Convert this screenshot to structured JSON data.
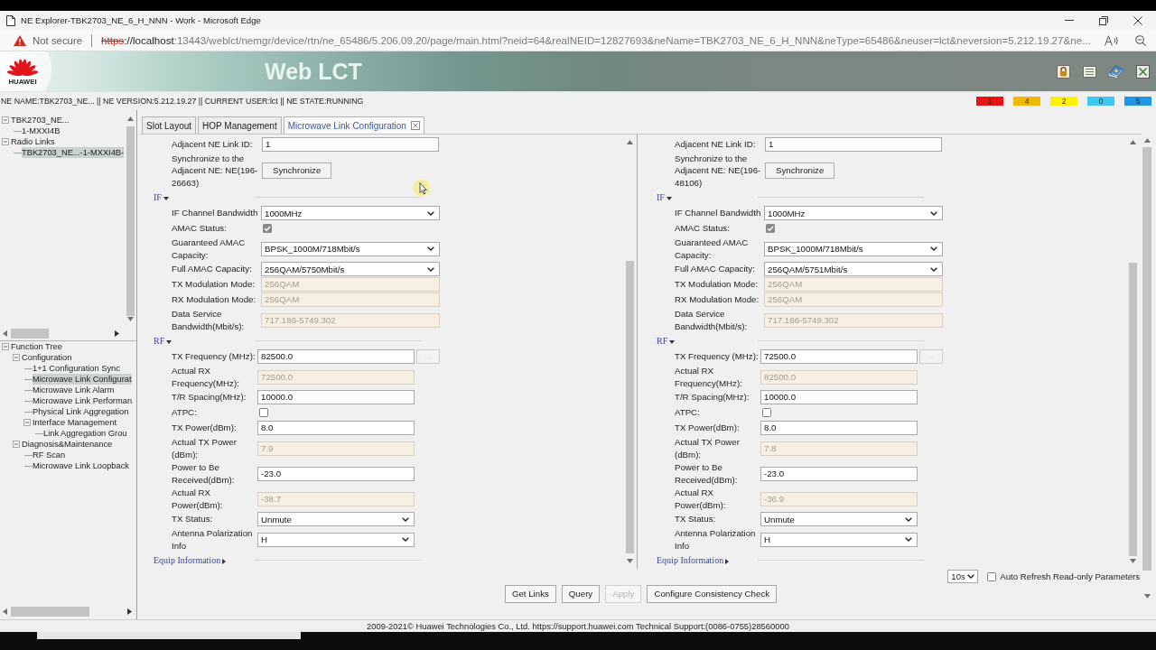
{
  "browser": {
    "title": "NE Explorer-TBK2703_NE_6_H_NNN - Work - Microsoft Edge",
    "security_label": "Not secure",
    "url_parts": [
      {
        "kind": "scheme",
        "text": "https"
      },
      {
        "kind": "host",
        "text": "://localhost"
      },
      {
        "kind": "path",
        "text": ":13443/weblct/nemgr/device/rtn/ne_65486/5.206.09.20/page/main.html?neid=64&realNEID=12827693&neName=TBK2703_NE_6_H_NNN&neType=65486&neuser=lct&neversion=5.212.19.27&ne..."
      }
    ]
  },
  "header": {
    "logo_text": "HUAWEI",
    "title": "Web LCT"
  },
  "status_bar": {
    "ne_info": "NE NAME:TBK2703_NE... || NE VERSION:5.212.19.27 || CURRENT USER:lct || NE STATE:RUNNING",
    "alarm_counts": [
      {
        "count": "1",
        "color": "#e81212"
      },
      {
        "count": "4",
        "color": "#f2b705"
      },
      {
        "count": "2",
        "color": "#fff200"
      },
      {
        "count": "0",
        "color": "#3cc8f0"
      },
      {
        "count": "5",
        "color": "#1e96e6"
      }
    ]
  },
  "ne_tree": [
    {
      "label": "TBK2703_NE...",
      "expanded": true,
      "selected": false,
      "children": [
        {
          "label": "1-MXXI4B",
          "selected": false
        }
      ]
    },
    {
      "label": "Radio Links",
      "expanded": true,
      "selected": false,
      "children": [
        {
          "label": "TBK2703_NE...-1-MXXI4B-",
          "selected": true
        }
      ]
    }
  ],
  "function_tree": [
    {
      "label": "Function Tree",
      "expanded": true,
      "selected": false,
      "children": [
        {
          "label": "Configuration",
          "expanded": true,
          "selected": false,
          "children": [
            {
              "label": "1+1 Configuration Sync",
              "selected": false
            },
            {
              "label": "Microwave Link Configurat",
              "selected": true
            },
            {
              "label": "Microwave Link Alarm",
              "selected": false
            },
            {
              "label": "Microwave Link Performan",
              "selected": false
            },
            {
              "label": "Physical Link Aggregation",
              "selected": false
            },
            {
              "label": "Interface Management",
              "expanded": true,
              "selected": false,
              "children": [
                {
                  "label": "Link Aggregation Grou",
                  "selected": false
                }
              ]
            }
          ]
        },
        {
          "label": "Diagnosis&Maintenance",
          "expanded": true,
          "selected": false,
          "children": [
            {
              "label": "RF Scan",
              "selected": false
            },
            {
              "label": "Microwave Link Loopback",
              "selected": false
            }
          ]
        }
      ]
    }
  ],
  "tabs": [
    {
      "label": "Slot Layout",
      "selected": false,
      "closable": false
    },
    {
      "label": "HOP Management",
      "selected": false,
      "closable": false
    },
    {
      "label": "Microwave Link Configuration",
      "selected": true,
      "closable": true
    }
  ],
  "link_panels": [
    {
      "rows": [
        {
          "kind": "input",
          "label": "Adjacent NE Link ID:",
          "value": "1"
        },
        {
          "kind": "action",
          "label": "Synchronize to the Adjacent NE: NE(196-26663)",
          "button": "Synchronize"
        }
      ],
      "sections": [
        {
          "title": "IF",
          "expanded": true,
          "fields": [
            {
              "kind": "select",
              "label": "IF Channel Bandwidth",
              "value": "1000MHz"
            },
            {
              "kind": "checkbox",
              "label": "AMAC Status:",
              "checked": true
            },
            {
              "kind": "select",
              "label": "Guaranteed AMAC Capacity:",
              "value": "BPSK_1000M/718Mbit/s"
            },
            {
              "kind": "select",
              "label": "Full AMAC Capacity:",
              "value": "256QAM/5750Mbit/s"
            },
            {
              "kind": "readonly",
              "label": "TX Modulation Mode:",
              "value": "256QAM"
            },
            {
              "kind": "readonly",
              "label": "RX Modulation Mode:",
              "value": "256QAM"
            },
            {
              "kind": "readonly",
              "label": "Data Service Bandwidth(Mbit/s):",
              "value": "717.186-5749.302"
            }
          ]
        },
        {
          "title": "RF",
          "expanded": true,
          "fields": [
            {
              "kind": "input_browse",
              "label": "TX Frequency (MHz):",
              "value": "82500.0",
              "button": "..."
            },
            {
              "kind": "readonly",
              "label": "Actual RX Frequency(MHz):",
              "value": "72500.0"
            },
            {
              "kind": "input",
              "label": "T/R Spacing(MHz):",
              "value": "10000.0"
            },
            {
              "kind": "checkbox",
              "label": "ATPC:",
              "checked": false
            },
            {
              "kind": "input",
              "label": "TX Power(dBm):",
              "value": "8.0"
            },
            {
              "kind": "readonly",
              "label": "Actual TX Power (dBm):",
              "value": "7.9"
            },
            {
              "kind": "input",
              "label": "Power to Be Received(dBm):",
              "value": "-23.0"
            },
            {
              "kind": "readonly",
              "label": "Actual RX Power(dBm):",
              "value": "-38.7"
            },
            {
              "kind": "select",
              "label": "TX Status:",
              "value": "Unmute"
            },
            {
              "kind": "select",
              "label": "Antenna Polarization Info",
              "value": "H"
            }
          ]
        },
        {
          "title": "Equip Information",
          "expanded": false
        }
      ]
    },
    {
      "rows": [
        {
          "kind": "input",
          "label": "Adjacent NE Link ID:",
          "value": "1"
        },
        {
          "kind": "action",
          "label": "Synchronize to the Adjacent NE: NE(196-48106)",
          "button": "Synchronize"
        }
      ],
      "sections": [
        {
          "title": "IF",
          "expanded": true,
          "fields": [
            {
              "kind": "select",
              "label": "IF Channel Bandwidth",
              "value": "1000MHz"
            },
            {
              "kind": "checkbox",
              "label": "AMAC Status:",
              "checked": true
            },
            {
              "kind": "select",
              "label": "Guaranteed AMAC Capacity:",
              "value": "BPSK_1000M/718Mbit/s"
            },
            {
              "kind": "select",
              "label": "Full AMAC Capacity:",
              "value": "256QAM/5751Mbit/s"
            },
            {
              "kind": "readonly",
              "label": "TX Modulation Mode:",
              "value": "256QAM"
            },
            {
              "kind": "readonly",
              "label": "RX Modulation Mode:",
              "value": "256QAM"
            },
            {
              "kind": "readonly",
              "label": "Data Service Bandwidth(Mbit/s):",
              "value": "717.186-5749.302"
            }
          ]
        },
        {
          "title": "RF",
          "expanded": true,
          "fields": [
            {
              "kind": "input_browse",
              "label": "TX Frequency (MHz):",
              "value": "72500.0",
              "button": "..."
            },
            {
              "kind": "readonly",
              "label": "Actual RX Frequency(MHz):",
              "value": "82500.0"
            },
            {
              "kind": "input",
              "label": "T/R Spacing(MHz):",
              "value": "10000.0"
            },
            {
              "kind": "checkbox",
              "label": "ATPC:",
              "checked": false
            },
            {
              "kind": "input",
              "label": "TX Power(dBm):",
              "value": "8.0"
            },
            {
              "kind": "readonly",
              "label": "Actual TX Power (dBm):",
              "value": "7.8"
            },
            {
              "kind": "input",
              "label": "Power to Be Received(dBm):",
              "value": "-23.0"
            },
            {
              "kind": "readonly",
              "label": "Actual RX Power(dBm):",
              "value": "-36.9"
            },
            {
              "kind": "select",
              "label": "TX Status:",
              "value": "Unmute"
            },
            {
              "kind": "select",
              "label": "Antenna Polarization Info",
              "value": "H"
            }
          ]
        },
        {
          "title": "Equip Information",
          "expanded": false
        }
      ]
    }
  ],
  "refresh": {
    "interval": "10s",
    "checked": false,
    "label": "Auto Refresh Read-only Parameters"
  },
  "buttons": [
    {
      "label": "Get Links",
      "disabled": false
    },
    {
      "label": "Query",
      "disabled": false
    },
    {
      "label": "Apply",
      "disabled": true
    },
    {
      "label": "Configure Consistency Check",
      "disabled": false
    }
  ],
  "footer": "2009-2021© Huawei Technologies Co., Ltd. https://support.huawei.com Technical Support:(0086-0755)28560000"
}
